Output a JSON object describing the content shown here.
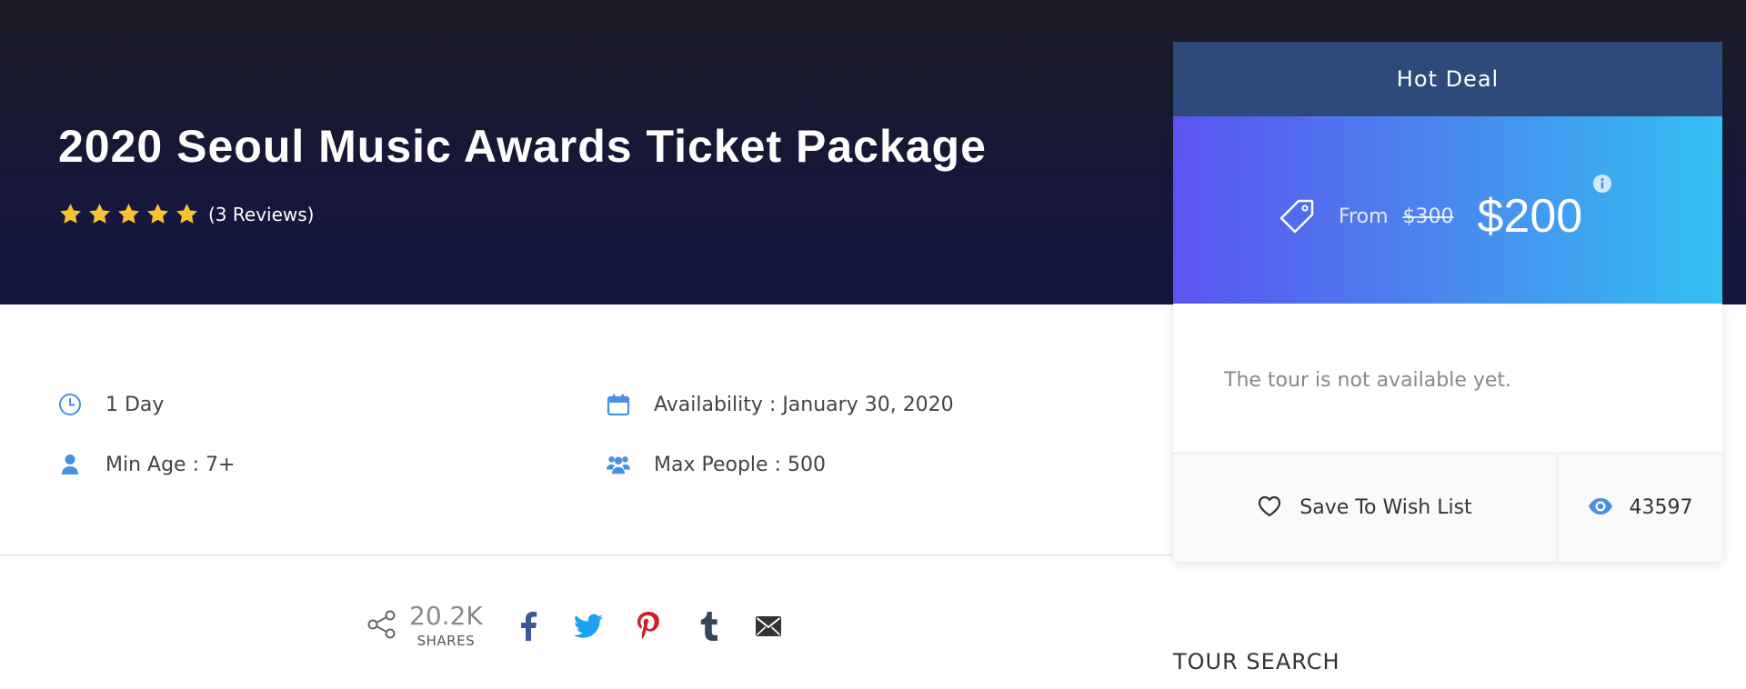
{
  "tour": {
    "title": "2020 Seoul Music Awards Ticket Package",
    "rating": 5,
    "reviews_text": "(3 Reviews)",
    "duration": "1 Day",
    "availability": "Availability : January 30, 2020",
    "min_age": "Min Age : 7+",
    "max_people": "Max People : 500"
  },
  "share": {
    "count": "20.2K",
    "label": "SHARES",
    "networks": [
      "facebook-icon",
      "twitter-icon",
      "pinterest-icon",
      "tumblr-icon",
      "email-icon"
    ]
  },
  "booking": {
    "header": "Hot Deal",
    "from_label": "From",
    "old_price": "$300",
    "price": "$200",
    "availability_note": "The tour is not available yet.",
    "wish_label": "Save To Wish List",
    "views": "43597"
  },
  "sidebar": {
    "search_title": "TOUR SEARCH"
  },
  "colors": {
    "hero_bg": "#16173a",
    "accent_blue": "#4a90e2",
    "deal_header": "#2d4a7a",
    "star": "#f7c233",
    "facebook": "#3b5998",
    "twitter": "#1da1f2",
    "pinterest": "#cb2027",
    "tumblr": "#35465c"
  }
}
